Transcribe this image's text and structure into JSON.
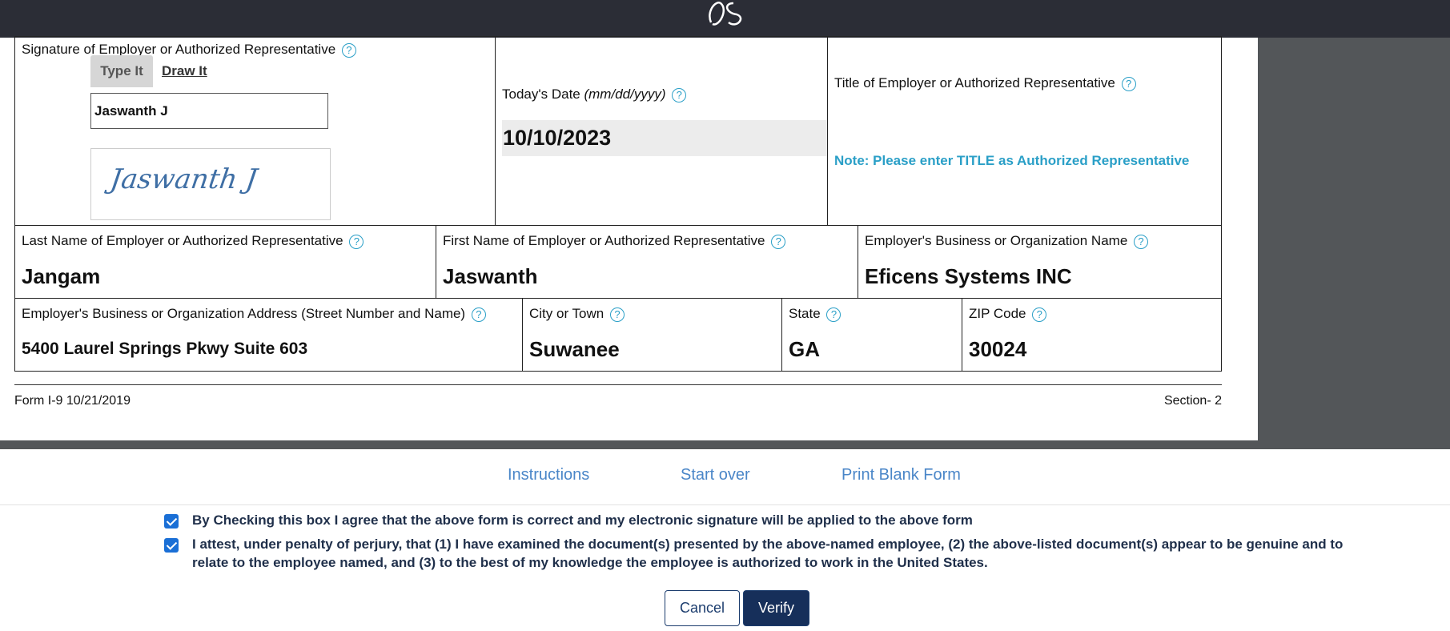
{
  "signature": {
    "label": "Signature of Employer or Authorized Representative",
    "tab_type": "Type It",
    "tab_draw": "Draw It",
    "typed_value": "Jaswanth J",
    "preview_text": "Jaswanth J"
  },
  "date": {
    "label": "Today's Date",
    "format_hint": "(mm/dd/yyyy)",
    "value": "10/10/2023"
  },
  "title_field": {
    "label": "Title of Employer or Authorized Representative",
    "note": "Note: Please enter TITLE as Authorized Representative"
  },
  "last_name": {
    "label": "Last Name of Employer or Authorized Representative",
    "value": "Jangam"
  },
  "first_name": {
    "label": "First Name of Employer or Authorized Representative",
    "value": "Jaswanth"
  },
  "business_name": {
    "label": "Employer's Business or Organization Name",
    "value": "Eficens Systems INC"
  },
  "address": {
    "label": "Employer's Business or Organization Address (Street Number and Name)",
    "value": "5400 Laurel Springs Pkwy Suite 603"
  },
  "city": {
    "label": "City or Town",
    "value": "Suwanee"
  },
  "state": {
    "label": "State",
    "value": "GA"
  },
  "zip": {
    "label": "ZIP Code",
    "value": "30024"
  },
  "help_glyph": "?",
  "footer": {
    "form_id": "Form I-9 10/21/2019",
    "section": "Section- 2"
  },
  "links": {
    "instructions": "Instructions",
    "start_over": "Start over",
    "print_blank": "Print Blank Form"
  },
  "checkboxes": [
    {
      "checked": true,
      "text": "By Checking this box I agree that the above form is correct and my electronic signature will be applied to the above form"
    },
    {
      "checked": true,
      "text": "I attest, under penalty of perjury, that (1) I have examined the document(s) presented by the above-named employee, (2) the above-listed document(s) appear to be genuine and to relate to the employee named, and (3) to the best of my knowledge the employee is authorized to work in the United States."
    }
  ],
  "buttons": {
    "cancel": "Cancel",
    "verify": "Verify"
  },
  "colors": {
    "accent": "#2a9fc7",
    "link": "#4a86c8",
    "primary_button": "#162f5a",
    "topbar": "#2b2d36"
  }
}
